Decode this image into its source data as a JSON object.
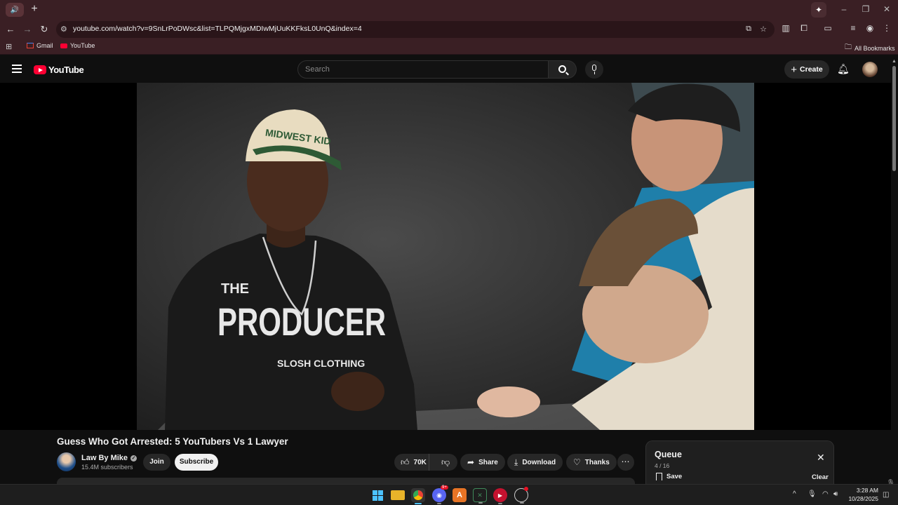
{
  "browser": {
    "url": "youtube.com/watch?v=9SnLrPoDWsc&list=TLPQMjgxMDIwMjUuKKFksL0UnQ&index=4",
    "bookmarks": [
      {
        "label": "Gmail",
        "icon": "gmail-icon"
      },
      {
        "label": "YouTube",
        "icon": "youtube-icon"
      }
    ],
    "all_bookmarks_label": "All Bookmarks"
  },
  "youtube": {
    "logo_text": "YouTube",
    "search_placeholder": "Search",
    "create_label": "Create"
  },
  "video": {
    "title": "Guess Who Got Arrested: 5 YouTubers Vs 1 Lawyer",
    "sweatshirt_text_1": "THE",
    "sweatshirt_text_2": "PRODUCER",
    "sweatshirt_text_3": "SLOSH CLOTHING",
    "cap_text": "MIDWEST KID"
  },
  "channel": {
    "name": "Law By Mike",
    "subscribers": "15.4M subscribers",
    "join_label": "Join",
    "subscribe_label": "Subscribe"
  },
  "actions": {
    "likes": "70K",
    "share_label": "Share",
    "download_label": "Download",
    "thanks_label": "Thanks"
  },
  "queue": {
    "title": "Queue",
    "position": "4 / 16",
    "save_label": "Save",
    "clear_label": "Clear"
  },
  "taskbar": {
    "time": "3:28 AM",
    "date": "10/28/2025",
    "badge": "9+"
  },
  "colors": {
    "chrome_bg": "#3a1f24",
    "youtube_red": "#ff0033",
    "page_bg": "#0f0f0f"
  }
}
